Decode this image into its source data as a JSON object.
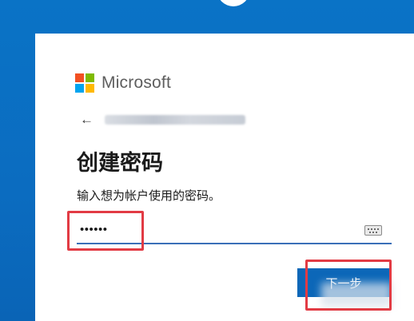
{
  "brand": {
    "name": "Microsoft",
    "logo_colors": [
      "#f25022",
      "#7fba00",
      "#00a4ef",
      "#ffb900"
    ]
  },
  "back": {
    "icon": "back-arrow-icon",
    "symbol": "←"
  },
  "page": {
    "title": "创建密码",
    "subtitle": "输入想为帐户使用的密码。"
  },
  "password": {
    "value": "••••••"
  },
  "keyboard": {
    "icon": "keyboard-icon"
  },
  "buttons": {
    "next_label": "下一步"
  },
  "colors": {
    "background": "#0a6fc2",
    "accent": "#0c67b8",
    "annotation": "#e23b44"
  }
}
